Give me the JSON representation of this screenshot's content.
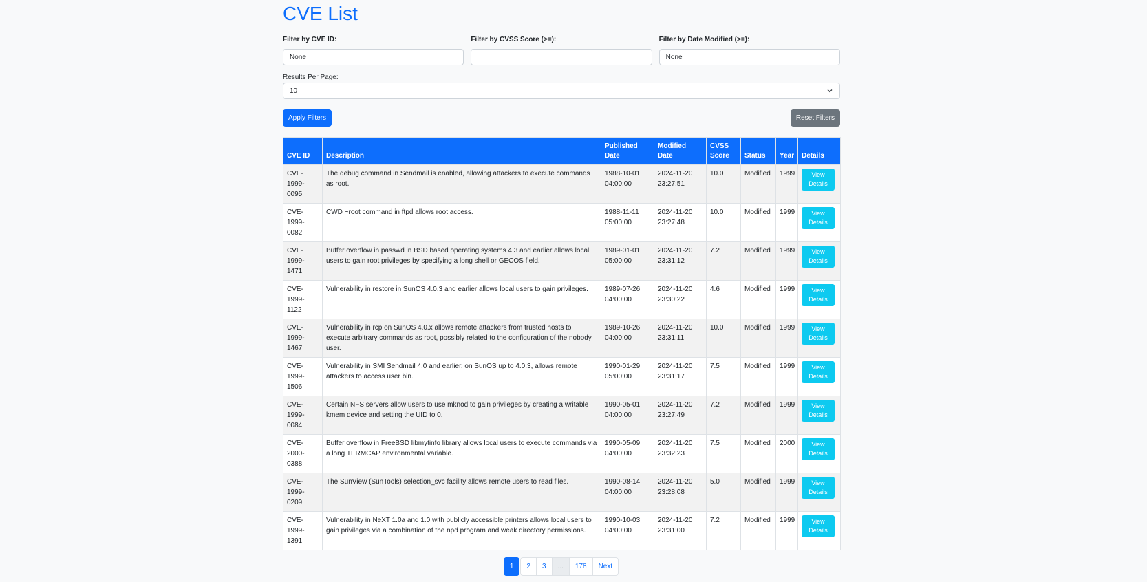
{
  "page_title": "CVE List",
  "filters": {
    "cve_id_label": "Filter by CVE ID:",
    "cve_id_value": "None",
    "cvss_label": "Filter by CVSS Score (>=):",
    "cvss_value": "",
    "date_label": "Filter by Date Modified (>=):",
    "date_value": "None"
  },
  "results_per_page": {
    "label": "Results Per Page:",
    "value": "10"
  },
  "buttons": {
    "apply": "Apply Filters",
    "reset": "Reset Filters"
  },
  "table": {
    "headers": [
      "CVE ID",
      "Description",
      "Published Date",
      "Modified Date",
      "CVSS Score",
      "Status",
      "Year",
      "Details"
    ],
    "rows": [
      {
        "id": "CVE-1999-0095",
        "desc": "The debug command in Sendmail is enabled, allowing attackers to execute commands as root.",
        "published": "1988-10-01 04:00:00",
        "modified": "2024-11-20 23:27:51",
        "cvss": "10.0",
        "status": "Modified",
        "year": "1999",
        "details": "View Details"
      },
      {
        "id": "CVE-1999-0082",
        "desc": "CWD ~root command in ftpd allows root access.",
        "published": "1988-11-11 05:00:00",
        "modified": "2024-11-20 23:27:48",
        "cvss": "10.0",
        "status": "Modified",
        "year": "1999",
        "details": "View Details"
      },
      {
        "id": "CVE-1999-1471",
        "desc": "Buffer overflow in passwd in BSD based operating systems 4.3 and earlier allows local users to gain root privileges by specifying a long shell or GECOS field.",
        "published": "1989-01-01 05:00:00",
        "modified": "2024-11-20 23:31:12",
        "cvss": "7.2",
        "status": "Modified",
        "year": "1999",
        "details": "View Details"
      },
      {
        "id": "CVE-1999-1122",
        "desc": "Vulnerability in restore in SunOS 4.0.3 and earlier allows local users to gain privileges.",
        "published": "1989-07-26 04:00:00",
        "modified": "2024-11-20 23:30:22",
        "cvss": "4.6",
        "status": "Modified",
        "year": "1999",
        "details": "View Details"
      },
      {
        "id": "CVE-1999-1467",
        "desc": "Vulnerability in rcp on SunOS 4.0.x allows remote attackers from trusted hosts to execute arbitrary commands as root, possibly related to the configuration of the nobody user.",
        "published": "1989-10-26 04:00:00",
        "modified": "2024-11-20 23:31:11",
        "cvss": "10.0",
        "status": "Modified",
        "year": "1999",
        "details": "View Details"
      },
      {
        "id": "CVE-1999-1506",
        "desc": "Vulnerability in SMI Sendmail 4.0 and earlier, on SunOS up to 4.0.3, allows remote attackers to access user bin.",
        "published": "1990-01-29 05:00:00",
        "modified": "2024-11-20 23:31:17",
        "cvss": "7.5",
        "status": "Modified",
        "year": "1999",
        "details": "View Details"
      },
      {
        "id": "CVE-1999-0084",
        "desc": "Certain NFS servers allow users to use mknod to gain privileges by creating a writable kmem device and setting the UID to 0.",
        "published": "1990-05-01 04:00:00",
        "modified": "2024-11-20 23:27:49",
        "cvss": "7.2",
        "status": "Modified",
        "year": "1999",
        "details": "View Details"
      },
      {
        "id": "CVE-2000-0388",
        "desc": "Buffer overflow in FreeBSD libmytinfo library allows local users to execute commands via a long TERMCAP environmental variable.",
        "published": "1990-05-09 04:00:00",
        "modified": "2024-11-20 23:32:23",
        "cvss": "7.5",
        "status": "Modified",
        "year": "2000",
        "details": "View Details"
      },
      {
        "id": "CVE-1999-0209",
        "desc": "The SunView (SunTools) selection_svc facility allows remote users to read files.",
        "published": "1990-08-14 04:00:00",
        "modified": "2024-11-20 23:28:08",
        "cvss": "5.0",
        "status": "Modified",
        "year": "1999",
        "details": "View Details"
      },
      {
        "id": "CVE-1999-1391",
        "desc": "Vulnerability in NeXT 1.0a and 1.0 with publicly accessible printers allows local users to gain privileges via a combination of the npd program and weak directory permissions.",
        "published": "1990-10-03 04:00:00",
        "modified": "2024-11-20 23:31:00",
        "cvss": "7.2",
        "status": "Modified",
        "year": "1999",
        "details": "View Details"
      }
    ]
  },
  "pagination": [
    "1",
    "2",
    "3",
    "...",
    "178",
    "Next"
  ],
  "colors": {
    "primary": "#0d6efd",
    "info": "#0dcaf0",
    "secondary": "#6c757d"
  }
}
